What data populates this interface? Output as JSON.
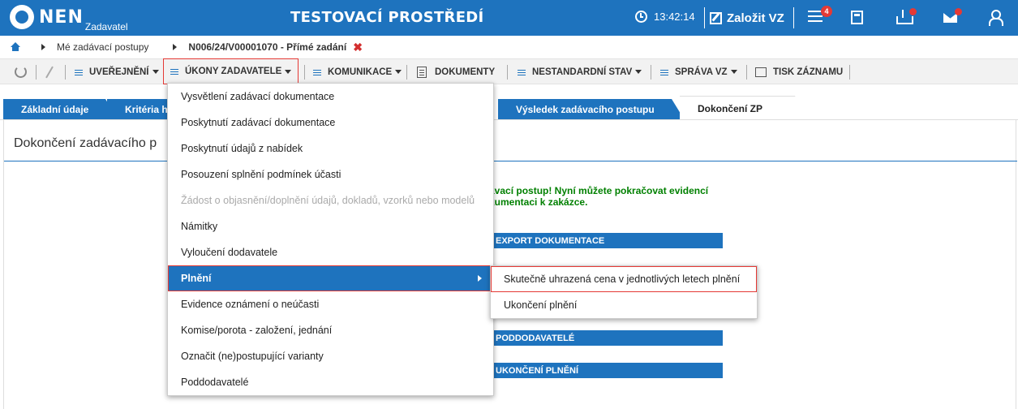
{
  "header": {
    "logo_text": "NEN",
    "logo_sub": "Zadavatel",
    "env_title": "TESTOVACÍ PROSTŘEDÍ",
    "time": "13:42:14",
    "create_label": "Založit VZ",
    "notification_count": "4",
    "accent_color": "#1e73be",
    "badge_color": "#e53935"
  },
  "breadcrumb": {
    "item1": "Mé zadávací postupy",
    "item2": "N006/24/V00001070 - Přímé zadání",
    "close": "✖"
  },
  "toolbar": {
    "uverejneni": "UVEŘEJNĚNÍ",
    "ukony": "ÚKONY ZADAVATELE",
    "komunikace": "KOMUNIKACE",
    "dokumenty": "DOKUMENTY",
    "nestandardni": "NESTANDARDNÍ STAV",
    "sprava": "SPRÁVA VZ",
    "tisk": "TISK ZÁZNAMU"
  },
  "tabs": {
    "t1": "Základní údaje",
    "t2": "Kritéria h",
    "t3": "Výsledek zadávacího postupu",
    "t4": "Dokončení ZP"
  },
  "section": {
    "title": "Dokončení zadávacího p",
    "msg_line1": "ávací postup! Nyní můžete pokračovat evidencí",
    "msg_line2": "kumentaci k zakázce.",
    "bar1": "EXPORT DOKUMENTACE",
    "bar2": "PODDODAVATELÉ",
    "bar3": "UKONČENÍ PLNĚNÍ"
  },
  "menu": {
    "items": [
      "Vysvětlení zadávací dokumentace",
      "Poskytnutí zadávací dokumentace",
      "Poskytnutí údajů z nabídek",
      "Posouzení splnění podmínek účasti",
      "Žádost o objasnění/doplnění údajů, dokladů, vzorků nebo modelů",
      "Námitky",
      "Vyloučení dodavatele",
      "Plnění",
      "Evidence oznámení o neúčasti",
      "Komise/porota - založení, jednání",
      "Označit (ne)postupující varianty",
      "Poddodavatelé"
    ],
    "disabled_index": 4,
    "highlight_index": 7
  },
  "submenu": {
    "items": [
      "Skutečně uhrazená cena v jednotlivých letech plnění",
      "Ukončení plnění"
    ]
  }
}
